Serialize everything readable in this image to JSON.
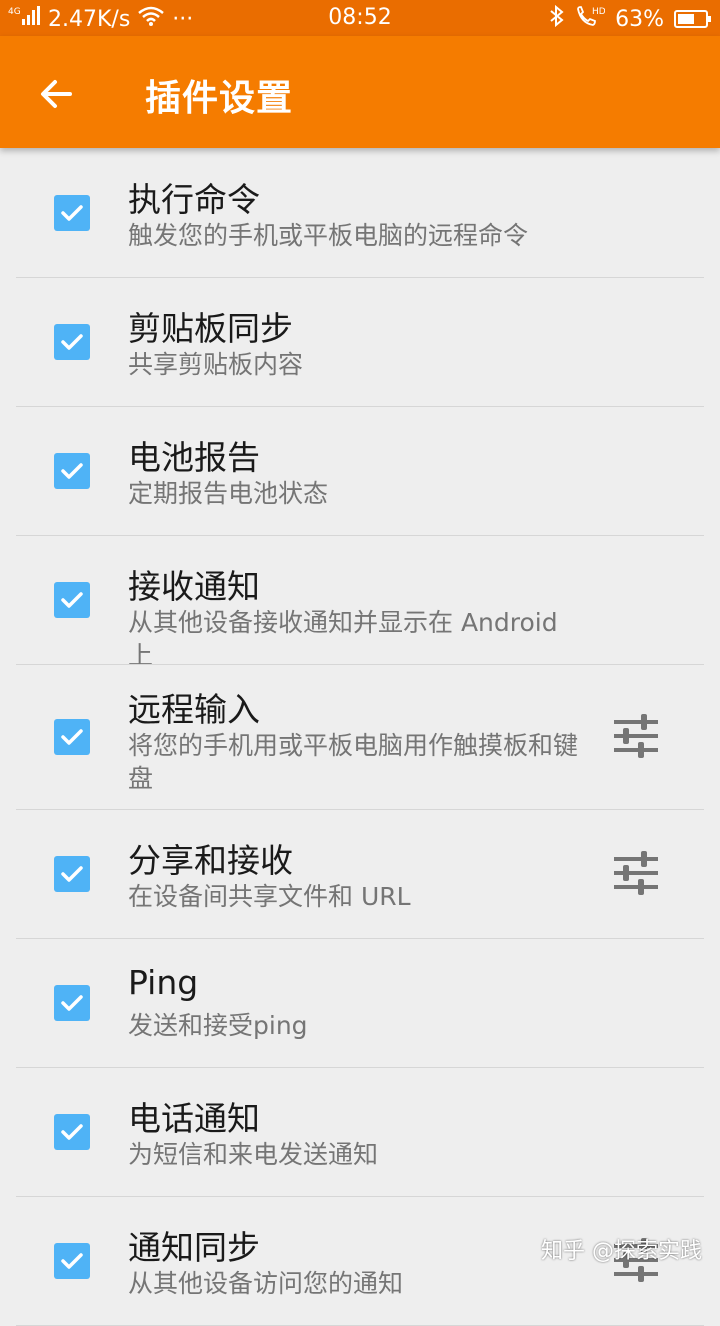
{
  "status_bar": {
    "network": "4G",
    "speed": "2.47K/s",
    "more": "···",
    "time": "08:52",
    "battery": "63%",
    "battery_level": 0.63,
    "icons": [
      "signal-icon",
      "wifi-icon",
      "bluetooth-icon",
      "hd-call-icon",
      "battery-icon"
    ]
  },
  "app_bar": {
    "title": "插件设置",
    "back_icon": "arrow-left-icon",
    "background": "#f57c00"
  },
  "checkbox_color": "#4fb3f6",
  "plugins": [
    {
      "title": "执行命令",
      "subtitle": "触发您的手机或平板电脑的远程命令",
      "checked": true,
      "has_settings": false
    },
    {
      "title": "剪贴板同步",
      "subtitle": "共享剪贴板内容",
      "checked": true,
      "has_settings": false
    },
    {
      "title": "电池报告",
      "subtitle": "定期报告电池状态",
      "checked": true,
      "has_settings": false
    },
    {
      "title": "接收通知",
      "subtitle": "从其他设备接收通知并显示在 Android 上",
      "checked": true,
      "has_settings": false
    },
    {
      "title": "远程输入",
      "subtitle": "将您的手机用或平板电脑用作触摸板和键盘",
      "checked": true,
      "has_settings": true
    },
    {
      "title": "分享和接收",
      "subtitle": "在设备间共享文件和 URL",
      "checked": true,
      "has_settings": true
    },
    {
      "title": "Ping",
      "subtitle": "发送和接受ping",
      "checked": true,
      "has_settings": false
    },
    {
      "title": "电话通知",
      "subtitle": "为短信和来电发送通知",
      "checked": true,
      "has_settings": false
    },
    {
      "title": "通知同步",
      "subtitle": "从其他设备访问您的通知",
      "checked": true,
      "has_settings": true
    }
  ],
  "watermark": "知乎 @探索实践"
}
